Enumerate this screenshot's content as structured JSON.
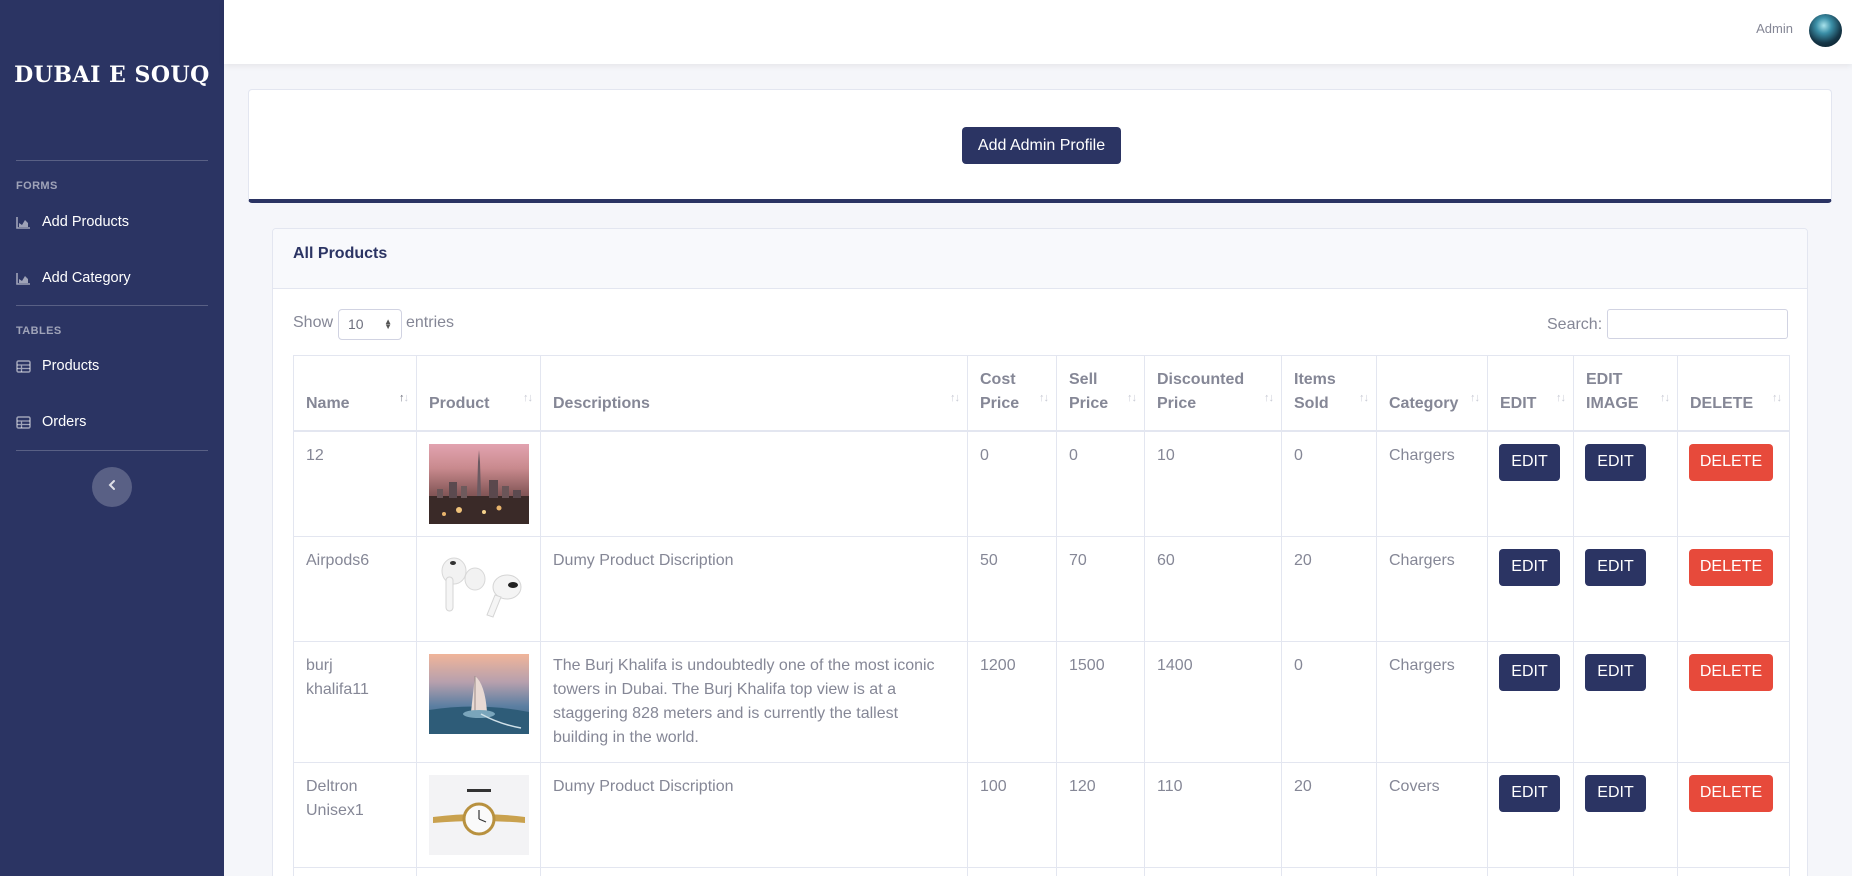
{
  "sidebar": {
    "brand": "DUBAI E SOUQ",
    "forms_heading": "FORMS",
    "tables_heading": "TABLES",
    "items": [
      {
        "label": "Add Products",
        "icon": "chart-area-icon"
      },
      {
        "label": "Add Category",
        "icon": "chart-area-icon"
      },
      {
        "label": "Products",
        "icon": "table-icon"
      },
      {
        "label": "Orders",
        "icon": "table-icon"
      }
    ],
    "toggle_icon": "chevron-left-icon"
  },
  "topbar": {
    "user_name": "Admin"
  },
  "admin_card": {
    "button_label": "Add Admin Profile"
  },
  "products": {
    "title": "All Products",
    "show_label": "Show",
    "entries_value": "10",
    "entries_label": "entries",
    "search_label": "Search:",
    "search_value": "",
    "columns": [
      [
        "Name"
      ],
      [
        "Product"
      ],
      [
        "Descriptions"
      ],
      [
        "Cost",
        "Price"
      ],
      [
        "Sell",
        "Price"
      ],
      [
        "Discounted",
        "Price"
      ],
      [
        "Items",
        "Sold"
      ],
      [
        "Category"
      ],
      [
        "EDIT"
      ],
      [
        "EDIT",
        "IMAGE"
      ],
      [
        "DELETE"
      ]
    ],
    "rows": [
      {
        "name": [
          "12"
        ],
        "image": "dubai-skyline-image",
        "description": "",
        "cost": "0",
        "sell": "0",
        "discounted": "10",
        "sold": "0",
        "category": "Chargers"
      },
      {
        "name": [
          "Airpods6"
        ],
        "image": "airpods-image",
        "description": "Dumy Product Discription",
        "cost": "50",
        "sell": "70",
        "discounted": "60",
        "sold": "20",
        "category": "Chargers"
      },
      {
        "name": [
          "burj",
          "khalifa11"
        ],
        "image": "burj-al-arab-image",
        "description": "The Burj Khalifa is undoubtedly one of the most iconic towers in Dubai. The Burj Khalifa top view is at a staggering 828 meters and is currently the tallest building in the world.",
        "cost": "1200",
        "sell": "1500",
        "discounted": "1400",
        "sold": "0",
        "category": "Chargers"
      },
      {
        "name": [
          "Deltron",
          "Unisex1"
        ],
        "image": "watch-image",
        "description": "Dumy Product Discription",
        "cost": "100",
        "sell": "120",
        "discounted": "110",
        "sold": "20",
        "category": "Covers"
      }
    ],
    "edit_label": "EDIT",
    "edit_image_label": "EDIT",
    "delete_label": "DELETE"
  },
  "colors": {
    "sidebar": "#2b3463",
    "primary_button": "#2b3463",
    "danger_button": "#e74a3b",
    "page_bg": "#f5f6fa"
  }
}
